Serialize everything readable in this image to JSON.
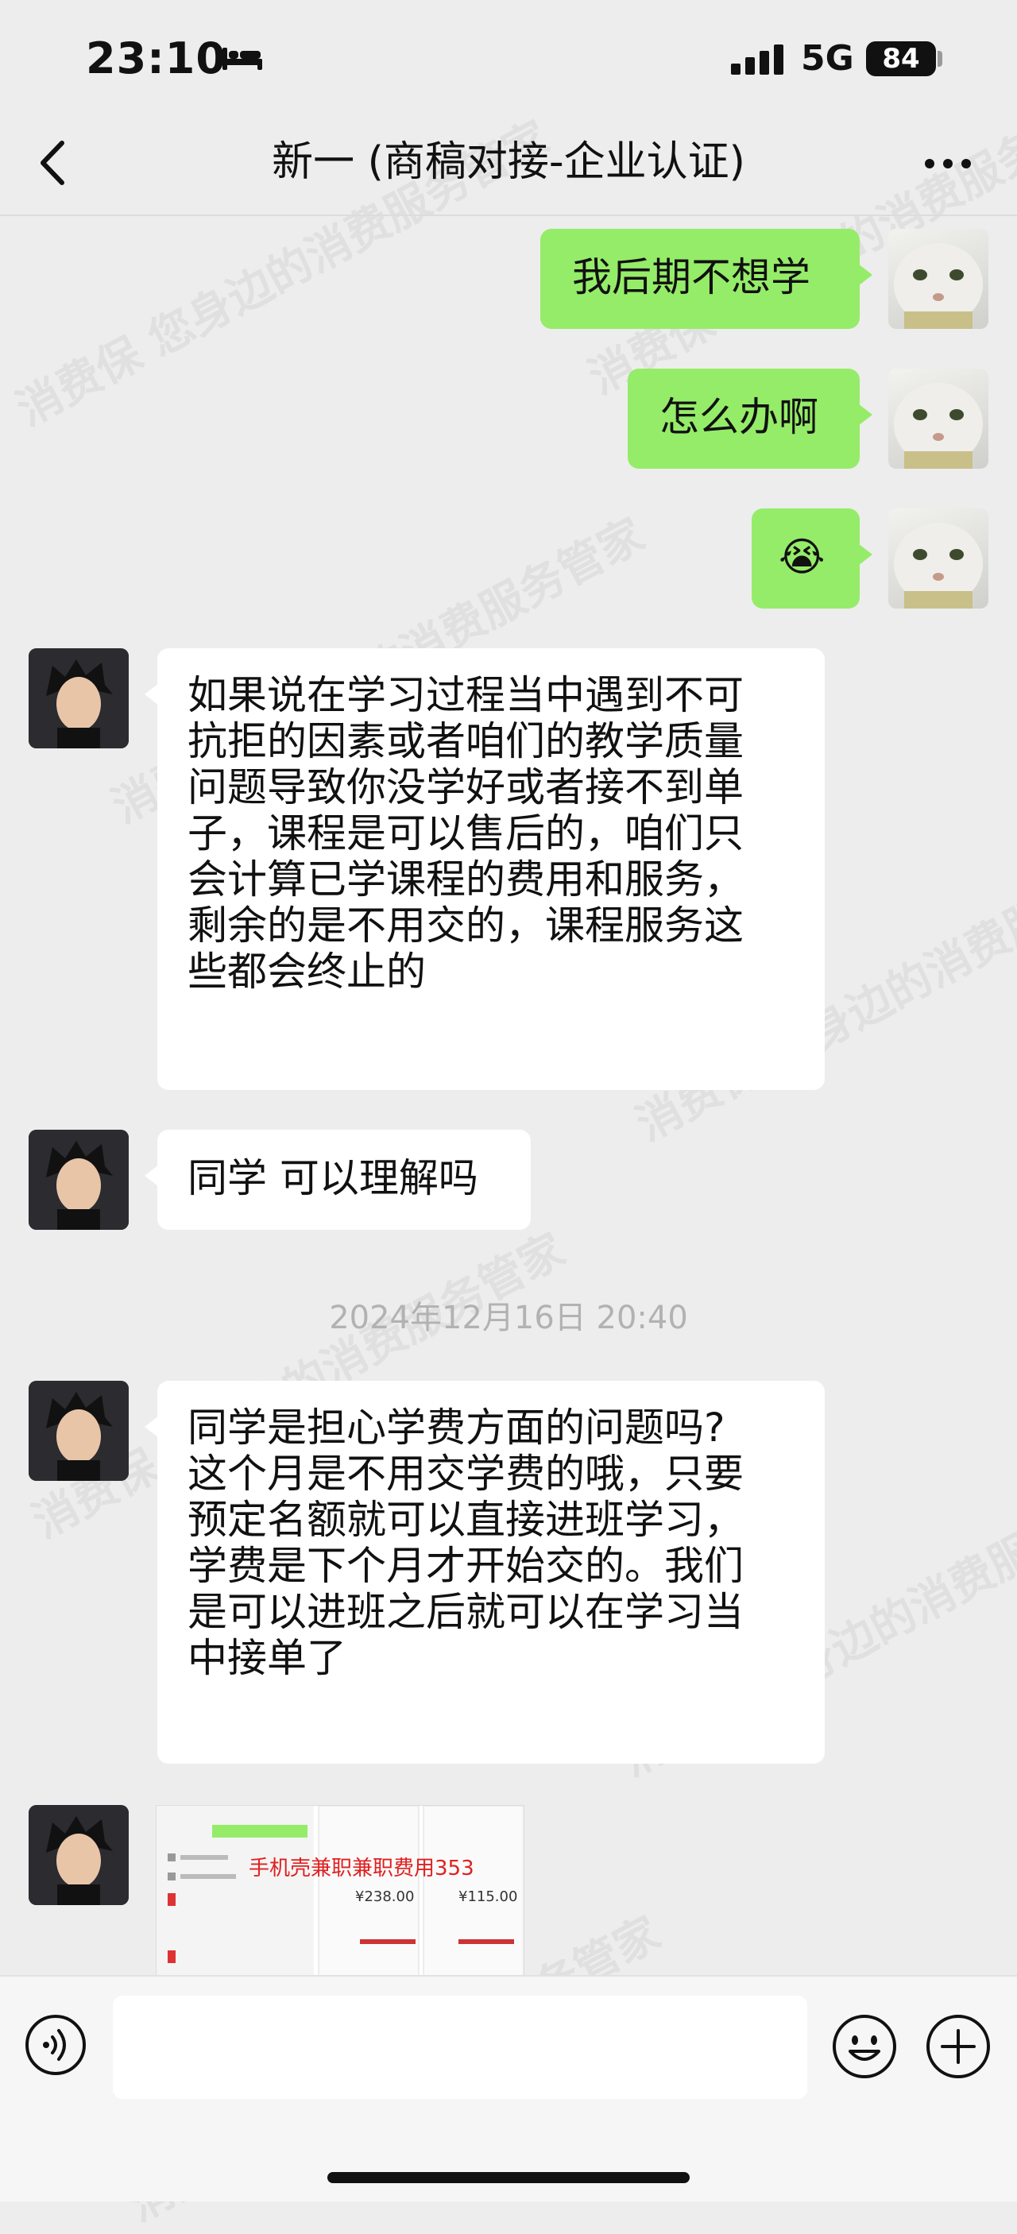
{
  "status_bar": {
    "time": "23:10",
    "network": "5G",
    "battery": "84"
  },
  "header": {
    "title": "新一 (商稿对接-企业认证)"
  },
  "messages": [
    {
      "sender": "me",
      "text": "我后期不想学"
    },
    {
      "sender": "me",
      "text": "怎么办啊"
    },
    {
      "sender": "me",
      "text": "😭"
    },
    {
      "sender": "them",
      "text": "如果说在学习过程当中遇到不可\n抗拒的因素或者咱们的教学质量\n问题导致你没学好或者接不到单\n子，课程是可以售后的，咱们只\n会计算已学课程的费用和服务，\n剩余的是不用交的，课程服务这\n些都会终止的"
    },
    {
      "sender": "them",
      "text": "同学 可以理解吗"
    },
    {
      "sender": "them",
      "text": "同学是担心学费方面的问题吗?\n这个月是不用交学费的哦，只要\n预定名额就可以直接进班学习，\n学费是下个月才开始交的。我们\n是可以进班之后就可以在学习当\n中接单了"
    }
  ],
  "timestamp": "2024年12月16日 20:40",
  "image_message": {
    "caption": "手机壳兼职兼职费用353",
    "price_a": "¥238.00",
    "price_b": "¥115.00"
  },
  "watermark": "消费保 您身边的消费服务管家",
  "input": {
    "placeholder": ""
  },
  "icons": {
    "back": "chevron-left-icon",
    "more": "more-dots-icon",
    "voice": "voice-icon",
    "emoji": "emoji-icon",
    "plus": "plus-icon"
  },
  "colors": {
    "sent_bubble": "#95ec69",
    "received_bubble": "#ffffff",
    "background": "#ededed"
  }
}
